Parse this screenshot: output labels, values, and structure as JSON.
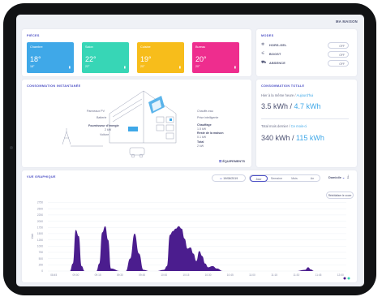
{
  "header": {
    "brand": "MA MAISON"
  },
  "rooms": {
    "title": "PIÈCES",
    "items": [
      {
        "name": "Chambre",
        "temp": "18°",
        "setpoint": "18°",
        "color": "#3fa8e8"
      },
      {
        "name": "Salon",
        "temp": "22°",
        "setpoint": "22°",
        "color": "#37d6b6"
      },
      {
        "name": "Cuisine",
        "temp": "19°",
        "setpoint": "20°",
        "color": "#f7bd1b"
      },
      {
        "name": "Bureau",
        "temp": "20°",
        "setpoint": "20°",
        "color": "#ee2d8e"
      }
    ]
  },
  "modes": {
    "title": "MODES",
    "items": [
      {
        "label": "HORS-GEL",
        "state": "OFF",
        "icon": "snowflake-icon"
      },
      {
        "label": "BOOST",
        "state": "OFF",
        "icon": "boost-icon"
      },
      {
        "label": "ABSENCE",
        "state": "OFF",
        "icon": "car-icon"
      }
    ]
  },
  "instant": {
    "title": "CONSOMMATION INSTANTANÉE",
    "labels": {
      "pv": "Panneaux PV",
      "battery": "Batterie",
      "supplier": "Fournisseur d'énergie",
      "supplier_value": "2 kW",
      "vehicle": "Voiture",
      "water": "Chauffe-eau",
      "smart_plugs": "Prise intelligente",
      "heating": "Chauffage",
      "heating_value": "1.5 kW",
      "rest": "Reste de la maison",
      "rest_value": "0.1 kW",
      "total": "Total",
      "total_value": "2 kW"
    },
    "equipment_link": "ÉQUIPEMENTS"
  },
  "totals": {
    "title": "CONSOMMATION TOTALE",
    "yesterday_label": "Hier à la même heure",
    "today_label": "Aujourd'hui",
    "yesterday_value": "3.5 kWh",
    "today_value": "4.7 kWh",
    "month_label": "Total mois dernier",
    "month_current_label": "Ce mois-ci",
    "month_value": "340 kWh",
    "month_current_value": "115 kWh"
  },
  "chart": {
    "title": "VUE GRAPHIQUE",
    "date": "19/08/2019",
    "periods": [
      "Jour",
      "Semaine",
      "Mois",
      "An"
    ],
    "selected_period": "Jour",
    "scope": "Domicile",
    "reset_zoom": "Réinitialiser le zoom",
    "ylabel": "Watt"
  },
  "chart_data": {
    "type": "area",
    "title": "",
    "xlabel": "",
    "ylabel": "Watt",
    "xticks": [
      "08:45",
      "09:00",
      "09:15",
      "09:30",
      "09:45",
      "10:00",
      "10:15",
      "10:30",
      "10:45",
      "11:00",
      "11:15",
      "11:30",
      "11:45",
      "12:00"
    ],
    "yticks": [
      0,
      250,
      500,
      750,
      1000,
      1250,
      1500,
      1750,
      2000,
      2250,
      2500,
      2750
    ],
    "ylim": [
      0,
      2800
    ],
    "color": "#4b1d8e",
    "series": [
      {
        "x": [
          "08:45",
          "08:48",
          "08:51",
          "08:54",
          "08:56",
          "08:58",
          "09:00",
          "09:02",
          "09:04",
          "09:06",
          "09:10",
          "09:14",
          "09:16",
          "09:18",
          "09:20",
          "09:22",
          "09:24",
          "09:30",
          "09:34",
          "09:37",
          "09:40",
          "09:43",
          "09:46",
          "09:50",
          "09:55",
          "10:00",
          "10:02",
          "10:04",
          "10:06",
          "10:08",
          "10:10",
          "10:12",
          "10:14",
          "10:16",
          "10:18",
          "10:20",
          "10:22",
          "10:24",
          "10:26",
          "10:28",
          "10:30",
          "10:33",
          "10:36",
          "10:40",
          "10:45",
          "11:00",
          "11:15",
          "11:30",
          "11:36",
          "11:38",
          "11:40",
          "11:42",
          "11:45",
          "11:55",
          "12:00"
        ],
        "y": [
          0,
          0,
          0,
          0,
          0,
          300,
          1650,
          1400,
          200,
          0,
          0,
          0,
          300,
          1550,
          1800,
          1250,
          100,
          0,
          0,
          500,
          1500,
          700,
          50,
          0,
          0,
          50,
          200,
          1450,
          1600,
          1700,
          1800,
          1700,
          1300,
          900,
          950,
          700,
          400,
          800,
          600,
          300,
          150,
          200,
          100,
          0,
          0,
          0,
          0,
          0,
          50,
          150,
          60,
          0,
          0,
          0,
          0
        ]
      }
    ],
    "legend_dots": [
      "#4b1d8e",
      "#37d6b6"
    ]
  }
}
